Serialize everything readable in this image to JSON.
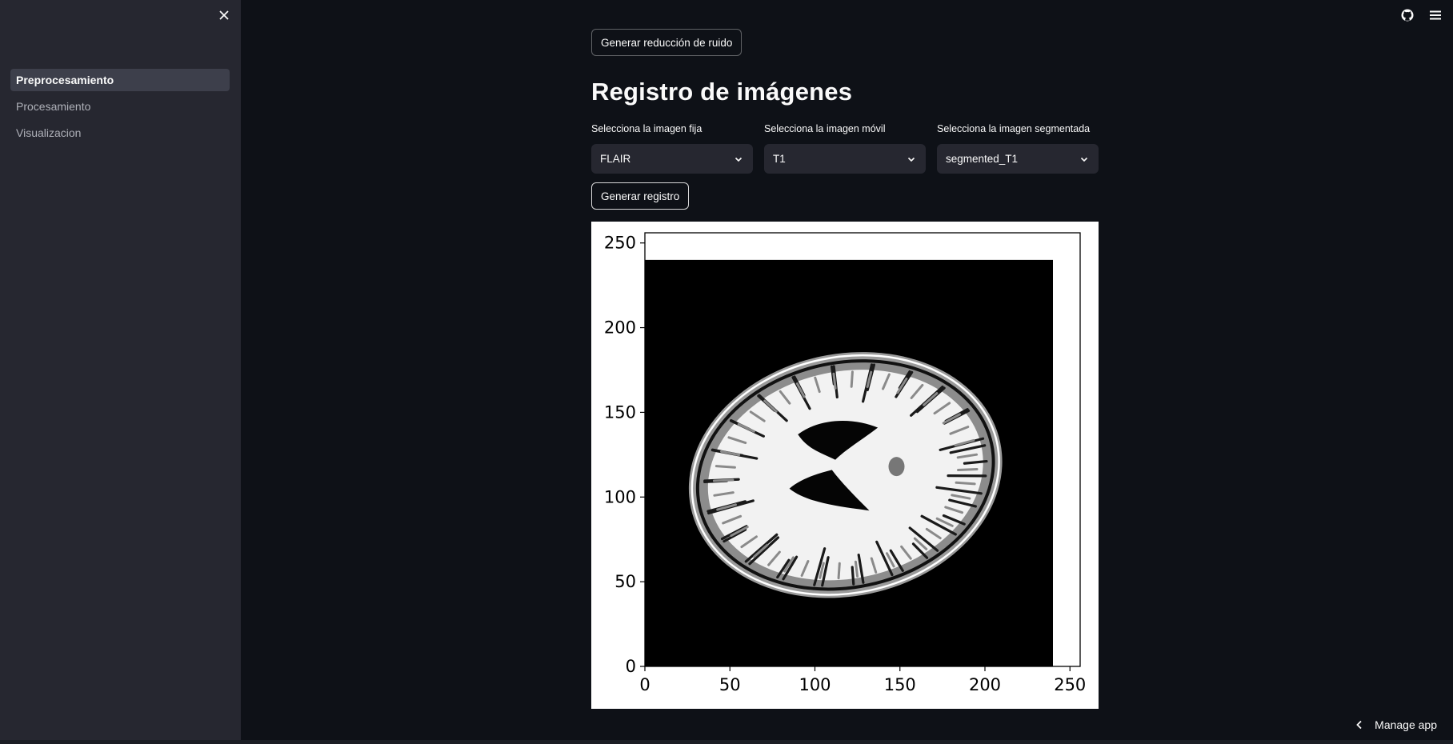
{
  "sidebar": {
    "items": [
      {
        "label": "Preprocesamiento",
        "active": true
      },
      {
        "label": "Procesamiento",
        "active": false
      },
      {
        "label": "Visualizacion",
        "active": false
      }
    ],
    "close_icon": "close-icon"
  },
  "header": {
    "github_icon": "github-icon",
    "menu_icon": "hamburger-menu-icon"
  },
  "main": {
    "denoise_button": "Generar reducción de ruido",
    "section_title": "Registro de imágenes",
    "selects": [
      {
        "label": "Selecciona la imagen fija",
        "value": "FLAIR"
      },
      {
        "label": "Selecciona la imagen móvil",
        "value": "T1"
      },
      {
        "label": "Selecciona la imagen segmentada",
        "value": "segmented_T1"
      }
    ],
    "register_button": "Generar registro"
  },
  "chart_data": {
    "type": "image",
    "xlim": [
      0,
      256
    ],
    "ylim": [
      0,
      256
    ],
    "xticks": [
      "0",
      "50",
      "100",
      "150",
      "200",
      "250"
    ],
    "yticks": [
      "0",
      "50",
      "100",
      "150",
      "200",
      "250"
    ],
    "image_extent": [
      0,
      240,
      0,
      240
    ]
  },
  "footer": {
    "manage_app": "Manage app"
  },
  "colors": {
    "background": "#0e1117",
    "sidebar": "#262730",
    "select_bg": "#262730"
  }
}
